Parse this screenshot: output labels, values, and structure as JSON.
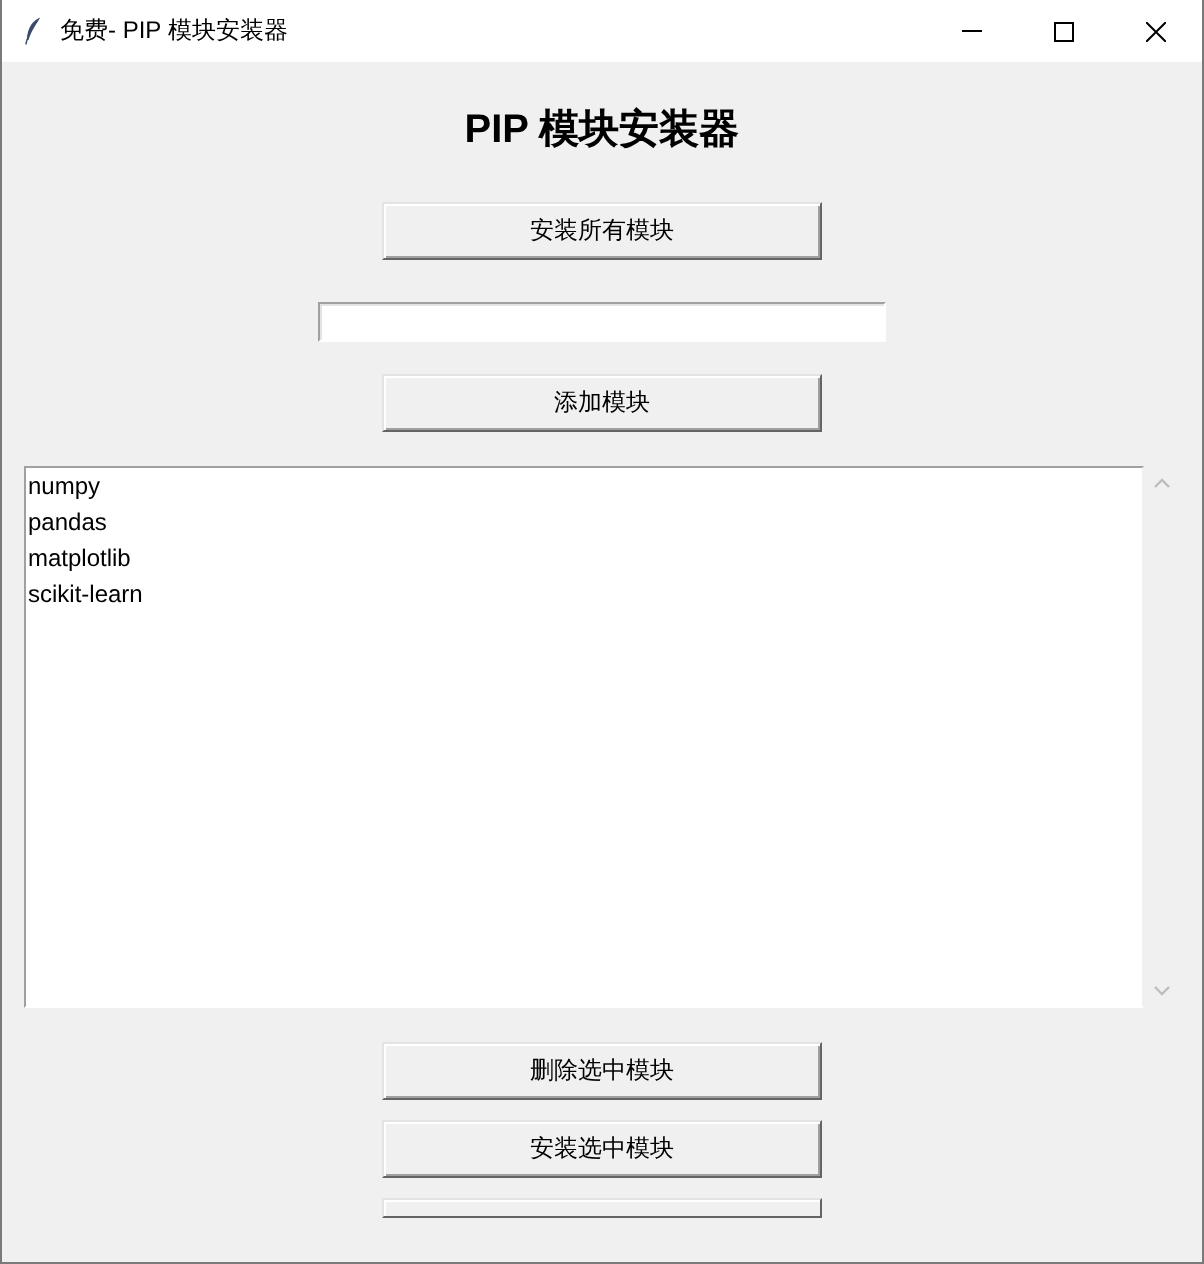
{
  "window": {
    "title": "免费- PIP 模块安装器"
  },
  "heading": "PIP 模块安装器",
  "controls": [
    {
      "kind": "button",
      "label": "安装所有模块"
    },
    {
      "kind": "entry"
    },
    {
      "kind": "button",
      "label": "添加模块"
    },
    {
      "kind": "listbox",
      "items": [
        {
          "text": "numpy",
          "selected": false
        },
        {
          "text": "pandas",
          "selected": false
        },
        {
          "text": "matplotlib",
          "selected": false
        },
        {
          "text": "scikit-learn",
          "selected": false
        }
      ]
    },
    {
      "kind": "button",
      "label": "删除选中模块"
    },
    {
      "kind": "button",
      "label": "安装选中模块"
    },
    {
      "kind": "clipped_button"
    }
  ]
}
